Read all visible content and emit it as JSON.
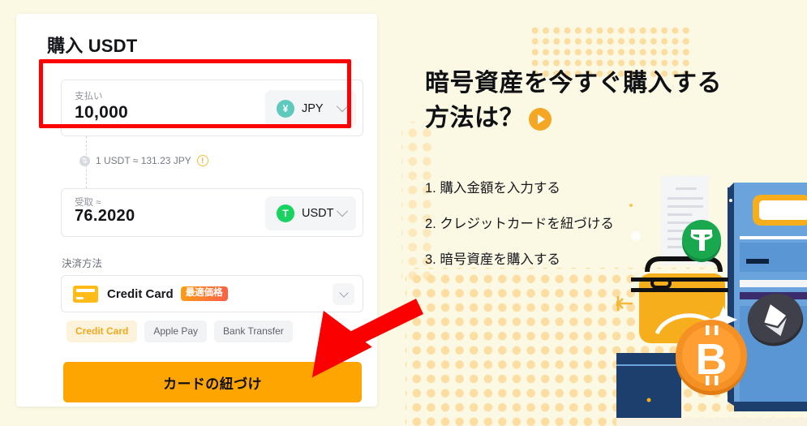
{
  "page": {
    "background_color": "#fbf8e3",
    "accent_color": "#ffa502",
    "highlight_color": "#ff0000"
  },
  "card": {
    "title": "購入 USDT",
    "pay_field": {
      "label": "支払い",
      "value": "10,000",
      "currency": {
        "code": "JPY",
        "symbol": "¥",
        "coin_color": "#5fc9bd",
        "chevron": "chevron-down-icon"
      }
    },
    "rate": {
      "icon": "swap-icon",
      "text": "1 USDT ≈ 131.23 JPY",
      "warning_icon": "!"
    },
    "receive_field": {
      "label": "受取 ≈",
      "value": "76.2020",
      "currency": {
        "code": "USDT",
        "symbol": "T",
        "coin_color": "#18d35f",
        "chevron": "chevron-down-icon"
      }
    },
    "payment_method": {
      "label": "決済方法",
      "selected_name": "Credit Card",
      "badge": "最適価格",
      "card_icon": "credit-card-icon",
      "chevron": "chevron-down-icon"
    },
    "method_pills": [
      {
        "label": "Credit Card",
        "active": true
      },
      {
        "label": "Apple Pay",
        "active": false
      },
      {
        "label": "Bank Transfer",
        "active": false
      }
    ],
    "cta_label": "カードの紐づけ"
  },
  "promo": {
    "title_line1": "暗号資産を今すぐ購入する",
    "title_line2": "方法は？",
    "play_icon": "play-button-icon",
    "steps": [
      "1. 購入金額を入力する",
      "2. クレジットカードを紐づける",
      "3. 暗号資産を購入する"
    ],
    "illustration": "crypto-atm-illustration"
  },
  "annotation": {
    "arrow": "red-arrow-pointing-to-cta",
    "highlight_box": "red-highlight-around-pay-field"
  }
}
